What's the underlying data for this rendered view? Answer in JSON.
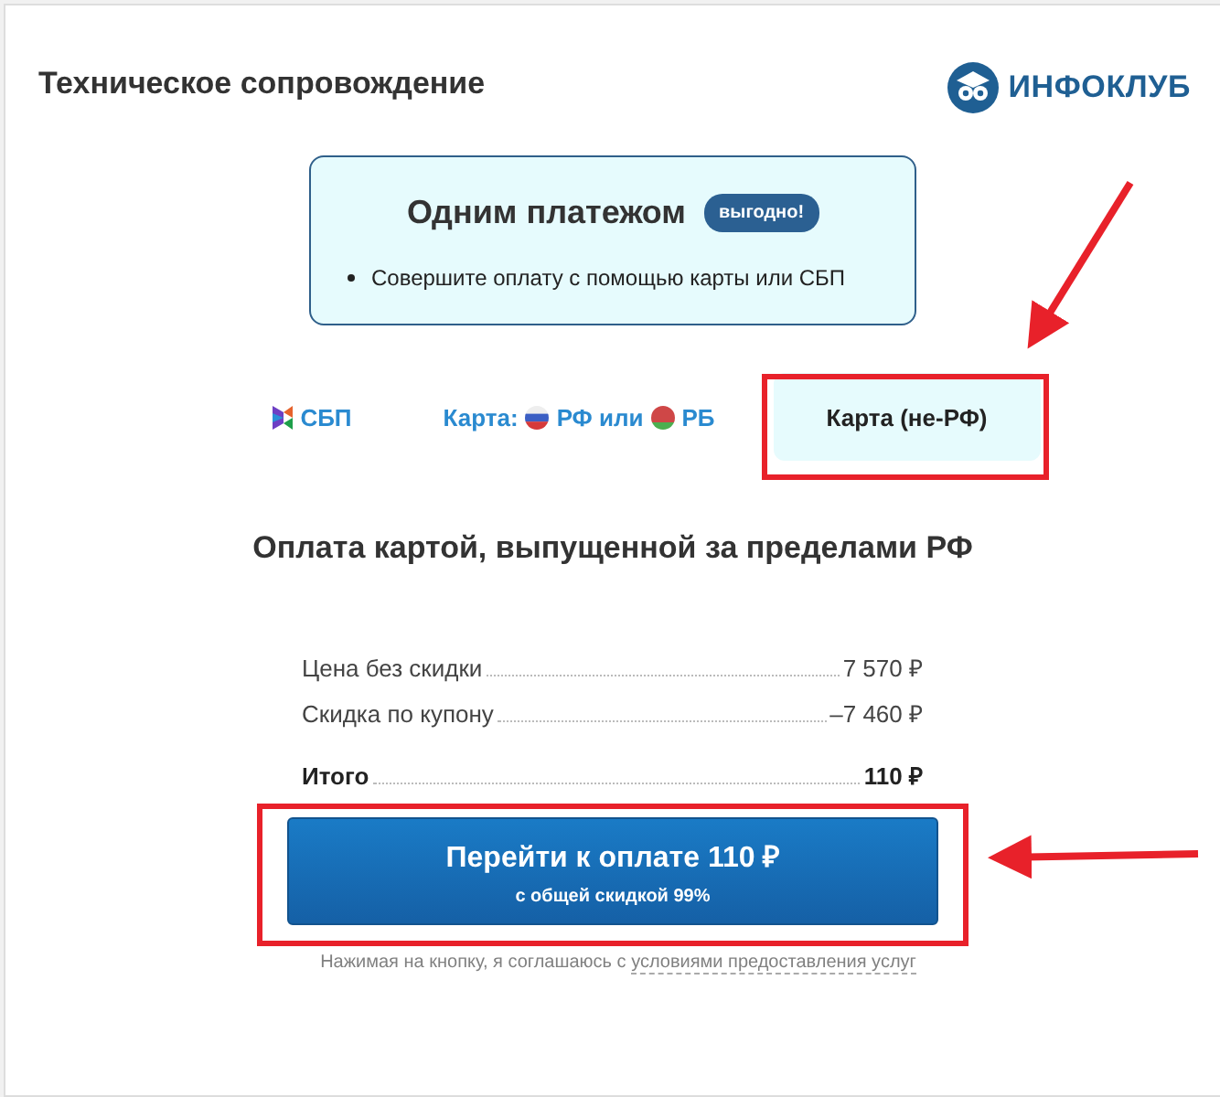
{
  "header": {
    "title": "Техническое сопровождение",
    "logo_text": "ИНФОКЛУБ"
  },
  "promo": {
    "title": "Одним платежом",
    "badge": "выгодно!",
    "bullets": [
      "Совершите оплату с помощью карты или СБП"
    ]
  },
  "tabs": [
    {
      "kind": "sbp",
      "parts": [
        "СБП"
      ],
      "selected": false
    },
    {
      "kind": "card_ru",
      "parts": [
        "Карта:",
        "РФ или",
        "РБ"
      ],
      "selected": false
    },
    {
      "kind": "card_foreign",
      "parts": [
        "Карта (не-РФ)"
      ],
      "selected": true
    }
  ],
  "heading": "Оплата картой, выпущенной за пределами РФ",
  "prices": [
    {
      "label": "Цена без скидки",
      "value": "7 570 ₽",
      "total": false
    },
    {
      "label": "Скидка по купону",
      "value": "–7 460 ₽",
      "total": false
    },
    {
      "label": "Итого",
      "value": "110 ₽",
      "total": true
    }
  ],
  "pay_button": {
    "label": "Перейти к оплате 110 ₽",
    "sublabel": "с общей скидкой 99%"
  },
  "terms": {
    "text": "Нажимая на кнопку, я соглашаюсь с",
    "link": "условиями предоставления услуг"
  }
}
